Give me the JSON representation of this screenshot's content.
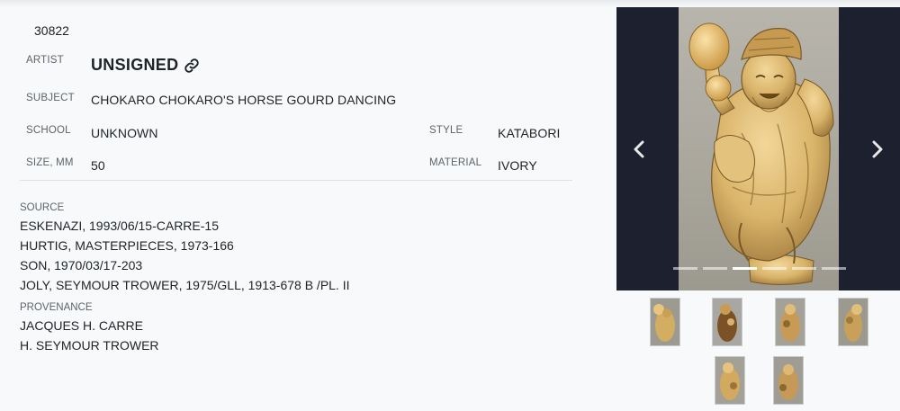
{
  "item": {
    "id": "30822"
  },
  "details": {
    "artist_label": "ARTIST",
    "artist_value": "UNSIGNED",
    "subject_label": "SUBJECT",
    "subject_value": "CHOKARO CHOKARO'S HORSE GOURD DANCING",
    "school_label": "SCHOOL",
    "school_value": "UNKNOWN",
    "style_label": "STYLE",
    "style_value": "KATABORI",
    "size_label": "SIZE, MM",
    "size_value": "50",
    "material_label": "MATERIAL",
    "material_value": "IVORY"
  },
  "source": {
    "title": "SOURCE",
    "items": [
      "ESKENAZI, 1993/06/15-CARRE-15",
      "HURTIG, MASTERPIECES, 1973-166",
      "SON, 1970/03/17-203",
      "JOLY, SEYMOUR TROWER, 1975/GLL, 1913-678 B /PL. II"
    ]
  },
  "provenance": {
    "title": "PROVENANCE",
    "items": [
      "JACQUES H. CARRE",
      "H. SEYMOUR TROWER"
    ]
  },
  "gallery": {
    "slide_count": 6,
    "active_slide": 3,
    "thumbnail_count": 6,
    "colors": {
      "panel": "#1c202f",
      "ivory": "#d9b46a",
      "shadow": "#8a6a2e"
    }
  },
  "icons": {
    "artist_link": "link-icon",
    "prev": "chevron-left-icon",
    "next": "chevron-right-icon"
  }
}
